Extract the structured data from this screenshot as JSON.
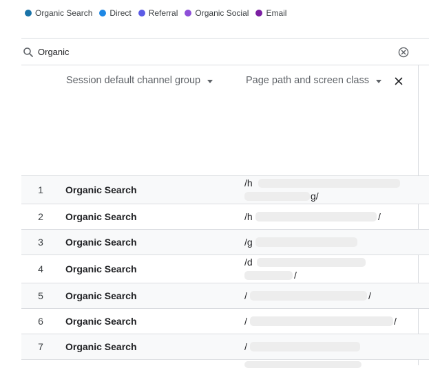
{
  "legend": [
    {
      "label": "Organic Search",
      "color": "#1a73a8"
    },
    {
      "label": "Direct",
      "color": "#1e88e5"
    },
    {
      "label": "Referral",
      "color": "#5c5ce6"
    },
    {
      "label": "Organic Social",
      "color": "#8e4fd8"
    },
    {
      "label": "Email",
      "color": "#7b1fa2"
    }
  ],
  "search": {
    "value": "Organic",
    "icon": "search-icon",
    "clear_icon": "close-circle-icon"
  },
  "table": {
    "columns": [
      {
        "label": "Session default channel group",
        "icon": "chevron-down-icon"
      },
      {
        "label": "Page path and screen class",
        "icon": "chevron-down-icon"
      }
    ],
    "remove_icon": "close-icon",
    "rows": [
      {
        "index": "1",
        "channel": "Organic Search",
        "path_start": "/h",
        "path_end": "g/"
      },
      {
        "index": "2",
        "channel": "Organic Search",
        "path_start": "/h",
        "path_end": "/"
      },
      {
        "index": "3",
        "channel": "Organic Search",
        "path_start": "/g",
        "path_end": ""
      },
      {
        "index": "4",
        "channel": "Organic Search",
        "path_start": "/d",
        "path_end": "/"
      },
      {
        "index": "5",
        "channel": "Organic Search",
        "path_start": "/",
        "path_end": "/"
      },
      {
        "index": "6",
        "channel": "Organic Search",
        "path_start": "/",
        "path_end": "/"
      },
      {
        "index": "7",
        "channel": "Organic Search",
        "path_start": "/",
        "path_end": ""
      }
    ]
  }
}
